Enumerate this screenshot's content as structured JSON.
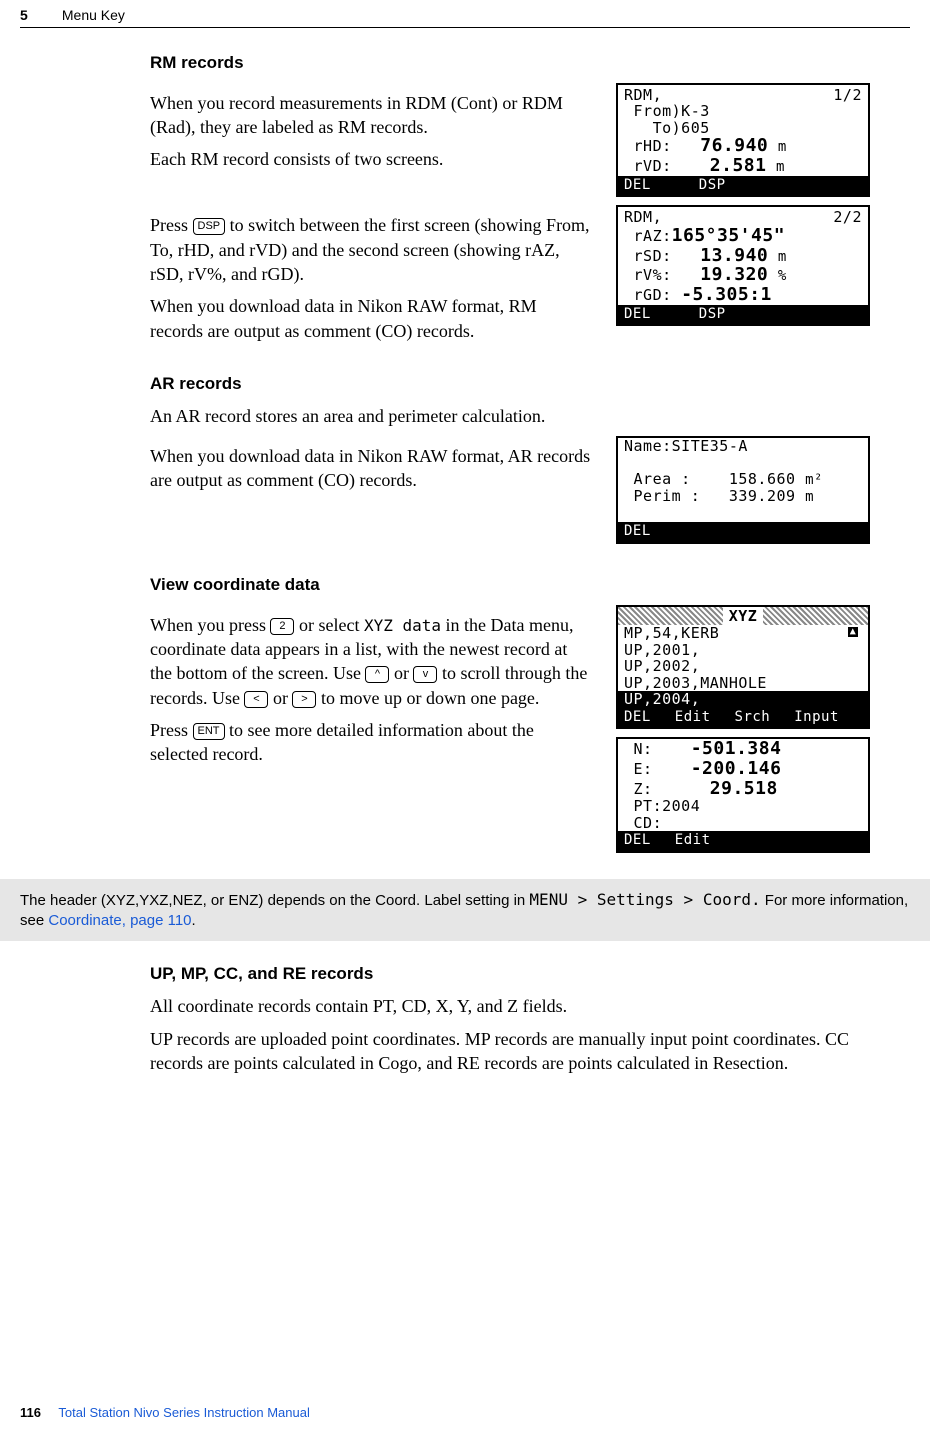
{
  "header": {
    "chapter": "5",
    "title": "Menu Key"
  },
  "footer": {
    "page": "116",
    "manual": "Total Station Nivo Series Instruction Manual"
  },
  "rm": {
    "heading": "RM records",
    "p1a": "When you record measurements in RDM (Cont) or RDM (Rad), they are labeled as RM records.",
    "p1b": "Each RM record consists of two screens.",
    "p2a_pre": "Press ",
    "p2a_key": "DSP",
    "p2a_post": " to switch between the first screen (showing From, To, rHD, and rVD) and the second screen (showing rAZ, rSD, rV%, and rGD).",
    "p2b": "When you download data in Nikon RAW format, RM records are output as comment (CO) records."
  },
  "rm_lcd1": {
    "title": "RDM,",
    "page": "1/2",
    "from": "From)K-3",
    "to": "To)605",
    "rhd_lbl": "rHD:",
    "rhd_val": "76.940",
    "rhd_unit": "m",
    "rvd_lbl": "rVD:",
    "rvd_val": "2.581",
    "rvd_unit": "m",
    "btn1": "DEL",
    "btn2": "DSP"
  },
  "rm_lcd2": {
    "title": "RDM,",
    "page": "2/2",
    "raz_lbl": "rAZ:",
    "raz_val": "165°35'45\"",
    "rsd_lbl": "rSD:",
    "rsd_val": "13.940",
    "rsd_unit": "m",
    "rv_lbl": "rV%:",
    "rv_val": "19.320",
    "rv_unit": "%",
    "rgd_lbl": "rGD:",
    "rgd_val": "-5.305:1",
    "btn1": "DEL",
    "btn2": "DSP"
  },
  "ar": {
    "heading": "AR records",
    "p1": "An AR record stores an area and perimeter calculation.",
    "p2": "When you download data in Nikon RAW format, AR records are output as comment (CO) records."
  },
  "ar_lcd": {
    "name_lbl": "Name:",
    "name_val": "SITE35-A",
    "area_lbl": "Area :",
    "area_val": "158.660",
    "area_unit": "m²",
    "perim_lbl": "Perim :",
    "perim_val": "339.209",
    "perim_unit": "m",
    "btn1": "DEL"
  },
  "view": {
    "heading": "View coordinate data",
    "p1_a": "When you press ",
    "p1_key2": "2",
    "p1_b": " or select ",
    "p1_menu": "XYZ data",
    "p1_c": " in the Data menu, coordinate data appears in a list, with the newest record at the bottom of the screen. Use ",
    "p1_up": "^",
    "p1_d": " or ",
    "p1_down": "v",
    "p1_e": " to scroll through the records. Use ",
    "p1_left": "<",
    "p1_f": " or ",
    "p1_right": ">",
    "p1_g": " to move up or down one page.",
    "p2_a": "Press ",
    "p2_key": "ENT",
    "p2_b": " to see more detailed information about the selected record."
  },
  "xyz_list": {
    "head": "XYZ",
    "r1": "MP,54,KERB",
    "r2": "UP,2001,",
    "r3": "UP,2002,",
    "r4": "UP,2003,MANHOLE",
    "r5": "UP,2004,",
    "btn1": "DEL",
    "btn2": "Edit",
    "btn3": "Srch",
    "btn4": "Input"
  },
  "xyz_detail": {
    "n_lbl": "N:",
    "n_val": "-501.384",
    "e_lbl": "E:",
    "e_val": "-200.146",
    "z_lbl": "Z:",
    "z_val": "29.518",
    "pt_lbl": "PT:",
    "pt_val": "2004",
    "cd_lbl": "CD:",
    "btn1": "DEL",
    "btn2": "Edit"
  },
  "note": {
    "t1": "The header (XYZ,YXZ,NEZ, or ENZ) depends on the Coord. Label setting in ",
    "path": "MENU > Settings > Coord.",
    "t2": " For more information, see ",
    "link": "Coordinate, page 110",
    "t3": "."
  },
  "upmp": {
    "heading": "UP, MP, CC, and RE records",
    "p1": "All coordinate records contain PT, CD, X, Y, and Z fields.",
    "p2": "UP records are uploaded point coordinates. MP records are manually input point coordinates. CC records are points calculated in Cogo, and RE records are points calculated in Resection."
  }
}
